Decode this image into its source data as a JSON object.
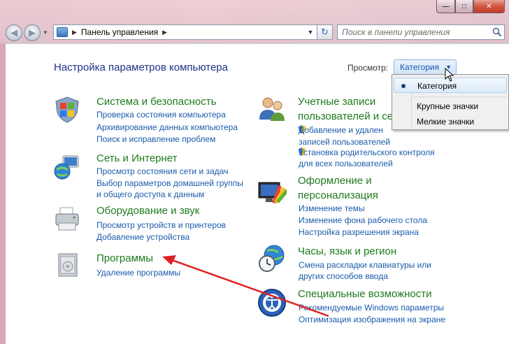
{
  "window": {
    "caption_min": "—",
    "caption_max": "□",
    "caption_close": "✕"
  },
  "navigation": {
    "address_path": "Панель управления",
    "search_placeholder": "Поиск в панели управления"
  },
  "header": {
    "title": "Настройка параметров компьютера",
    "view_label": "Просмотр:",
    "view_selected": "Категория"
  },
  "view_menu": {
    "items": [
      "Категория",
      "Крупные значки",
      "Мелкие значки"
    ],
    "checked_index": 0
  },
  "categories_left": [
    {
      "title": "Система и безопасность",
      "icon": "shield-flag-icon",
      "links": [
        "Проверка состояния компьютера",
        "Архивирование данных компьютера",
        "Поиск и исправление проблем"
      ]
    },
    {
      "title": "Сеть и Интернет",
      "icon": "network-globe-icon",
      "links": [
        "Просмотр состояния сети и задач",
        "Выбор параметров домашней группы",
        "и общего доступа к данным"
      ]
    },
    {
      "title": "Оборудование и звук",
      "icon": "printer-icon",
      "links": [
        "Просмотр устройств и принтеров",
        "Добавление устройства"
      ]
    },
    {
      "title": "Программы",
      "icon": "programs-icon",
      "links": [
        "Удаление программы"
      ]
    }
  ],
  "categories_right": [
    {
      "title_line1": "Учетные записи",
      "title_line2": "пользователей и се",
      "icon": "users-icon",
      "links": [
        "Добавление и удален",
        "записей пользователей",
        "Установка родительского контроля",
        "для всех пользователей"
      ]
    },
    {
      "title_line1": "Оформление и",
      "title_line2": "персонализация",
      "icon": "appearance-icon",
      "links": [
        "Изменение темы",
        "Изменение фона рабочего стола",
        "Настройка разрешения экрана"
      ]
    },
    {
      "title": "Часы, язык и регион",
      "icon": "clock-globe-icon",
      "links": [
        "Смена раскладки клавиатуры или",
        "других способов ввода"
      ]
    },
    {
      "title": "Специальные возможности",
      "icon": "accessibility-icon",
      "links": [
        "Рекомендуемые Windows параметры",
        "Оптимизация изображения на экране"
      ]
    }
  ],
  "colors": {
    "title_green": "#1e7a1e",
    "link_blue": "#1a5bab",
    "header_blue": "#1e3287",
    "annotation_red": "#e02020"
  }
}
